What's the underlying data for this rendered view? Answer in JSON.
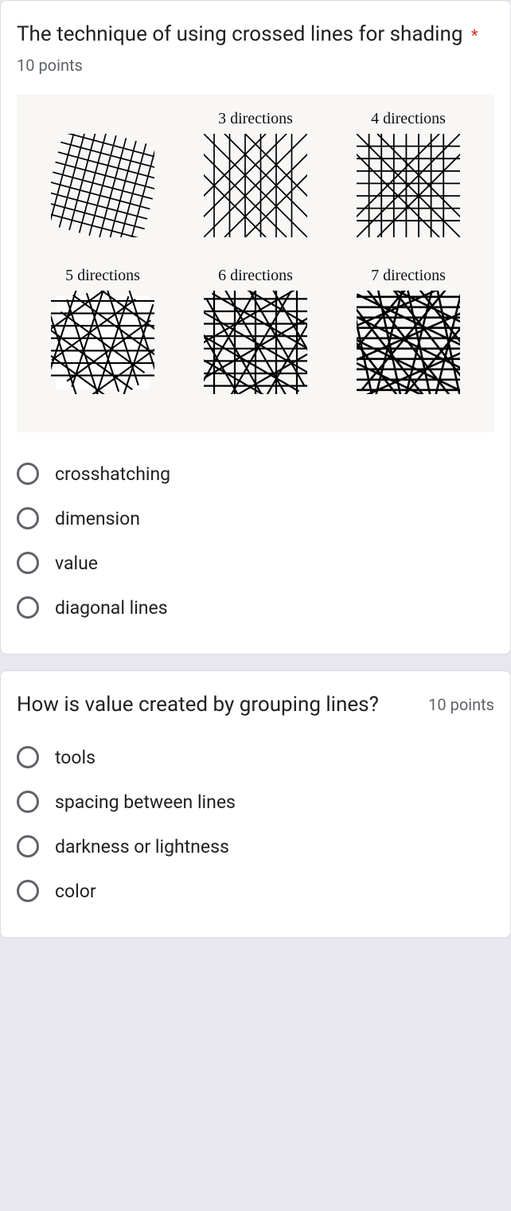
{
  "questions": [
    {
      "title": "The technique of using crossed lines for shading",
      "required": true,
      "points": "10 points",
      "image_labels": [
        "",
        "3 directions",
        "4 directions",
        "5 directions",
        "6 directions",
        "7 directions"
      ],
      "options": [
        "crosshatching",
        "dimension",
        "value",
        "diagonal lines"
      ]
    },
    {
      "title": "How is value created by grouping lines?",
      "required": false,
      "points": "10 points",
      "options": [
        "tools",
        "spacing between lines",
        "darkness or lightness",
        "color"
      ]
    }
  ]
}
